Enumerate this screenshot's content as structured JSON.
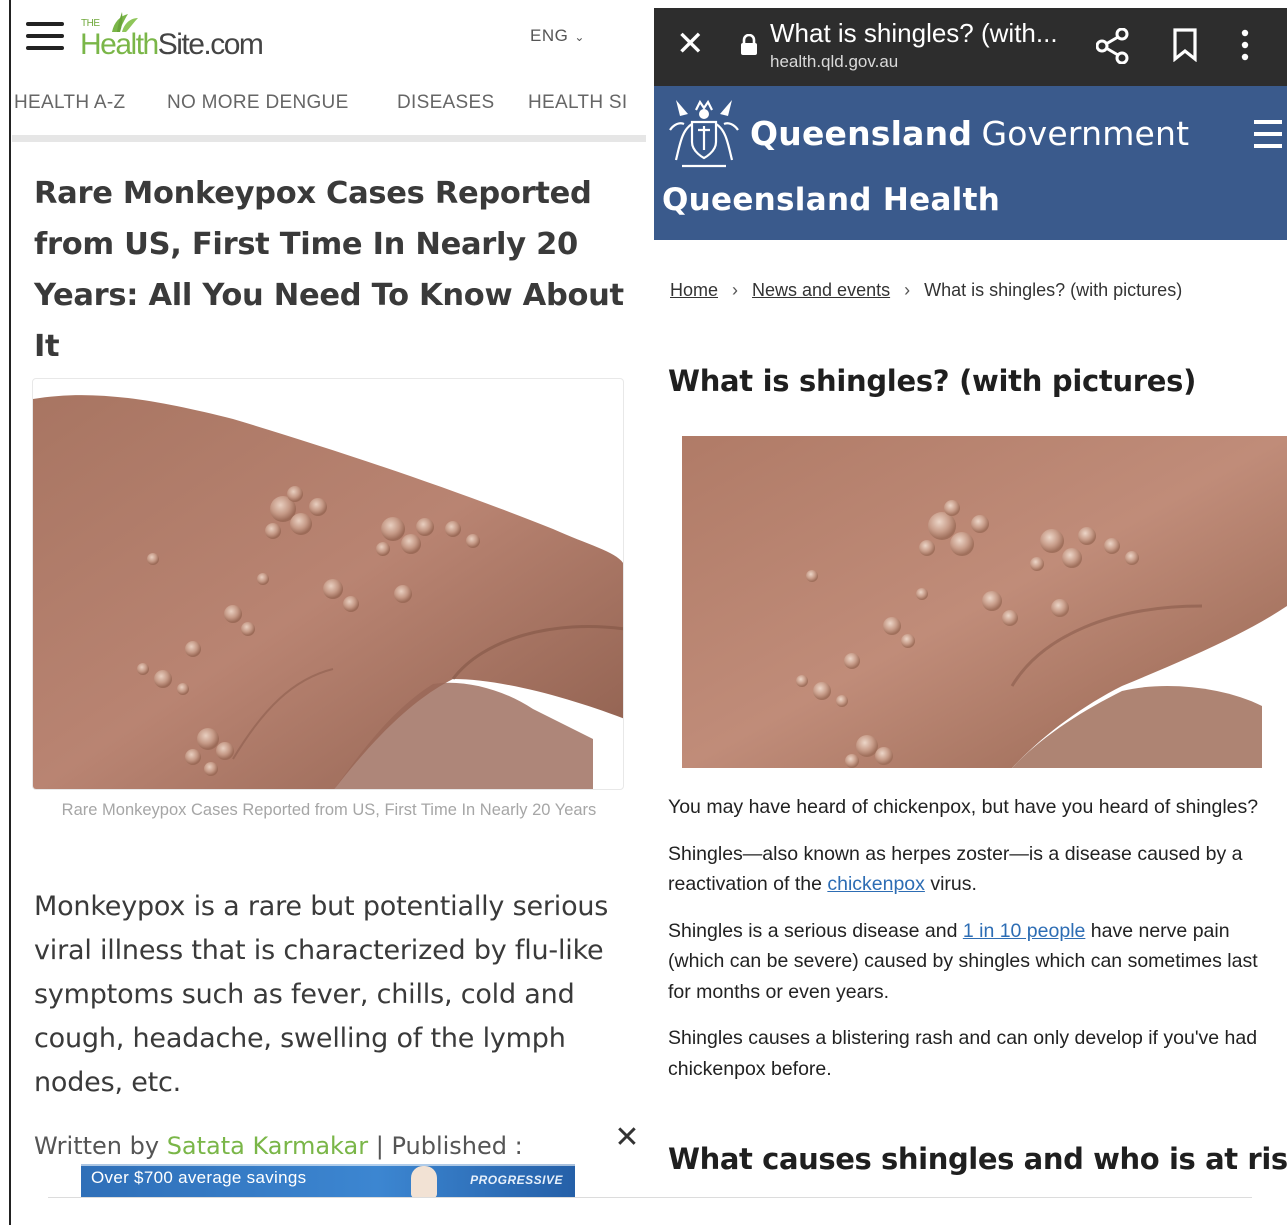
{
  "left_site": {
    "logo": {
      "prefix": "THE",
      "part1": "Health",
      "part2": "Site.com"
    },
    "language": "ENG",
    "nav": [
      "HEALTH A-Z",
      "NO MORE DENGUE",
      "DISEASES",
      "HEALTH SI"
    ],
    "article": {
      "title": "Rare Monkeypox Cases Reported from US, First Time In Nearly 20 Years: All You Need To Know About It",
      "image_caption": "Rare Monkeypox Cases Reported from US, First Time In Nearly 20 Years",
      "body": "Monkeypox is a rare but potentially serious viral illness that is characterized by flu-like symptoms such as fever, chills, cold and cough, headache, swelling of the lymph nodes, etc.",
      "byline_prefix": "Written by ",
      "author": "Satata Karmakar",
      "byline_suffix": " | Published :"
    },
    "ad": {
      "text": "Over $700 average savings",
      "brand": "PROGRESSIVE"
    }
  },
  "right_site": {
    "browser": {
      "tab_title": "What is shingles? (with...",
      "url": "health.qld.gov.au"
    },
    "banner": {
      "gov_bold": "Queensland",
      "gov_normal": "Government",
      "dept": "Queensland Health"
    },
    "breadcrumb": {
      "home": "Home",
      "news": "News and events",
      "current": "What is shingles? (with pictures)"
    },
    "heading": "What is shingles? (with pictures)",
    "paragraphs": {
      "p1": "You may have heard of chickenpox, but have you heard of shingles?",
      "p2_a": "Shingles—also known as herpes zoster—is a disease caused by a reactivation of the ",
      "p2_link": "chickenpox",
      "p2_b": " virus.",
      "p3_a": "Shingles is a serious disease and ",
      "p3_link": "1 in 10 people",
      "p3_b": " have nerve pain (which can be severe) caused by shingles which can sometimes last for months or even years.",
      "p4": "Shingles causes a blistering rash and can only develop if you've had chickenpox before."
    },
    "subheading": "What causes shingles and who is at risk?"
  },
  "colors": {
    "healthsite_green": "#7ab648",
    "chrome_bar": "#2d2d2d",
    "qld_blue": "#3a5a8c",
    "link_blue": "#2d6db4"
  }
}
